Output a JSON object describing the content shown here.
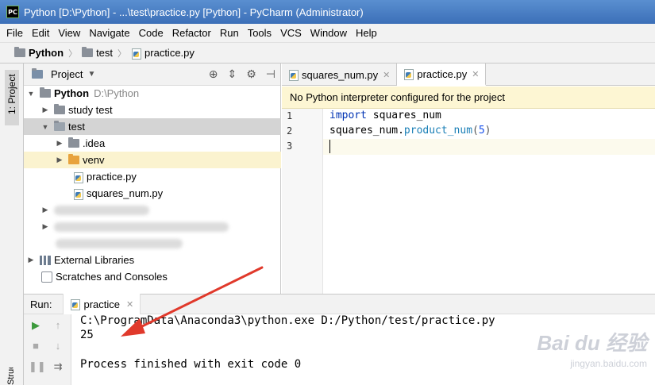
{
  "window": {
    "title": "Python [D:\\Python] - ...\\test\\practice.py [Python] - PyCharm (Administrator)",
    "app_icon_text": "PC"
  },
  "menu": [
    "File",
    "Edit",
    "View",
    "Navigate",
    "Code",
    "Refactor",
    "Run",
    "Tools",
    "VCS",
    "Window",
    "Help"
  ],
  "breadcrumb": [
    "Python",
    "test",
    "practice.py"
  ],
  "left_strip": {
    "project_tab": "1: Project",
    "structure_tab": "Structure"
  },
  "project_panel": {
    "title": "Project",
    "tree": [
      {
        "label": "Python",
        "suffix": "D:\\Python",
        "expanded": true
      },
      {
        "label": "study test",
        "expanded": false
      },
      {
        "label": "test",
        "expanded": true,
        "selected": true
      },
      {
        "label": ".idea",
        "expanded": false
      },
      {
        "label": "venv",
        "expanded": false
      },
      {
        "label": "practice.py"
      },
      {
        "label": "squares_num.py"
      },
      {
        "label": "External Libraries"
      },
      {
        "label": "Scratches and Consoles"
      }
    ]
  },
  "editor_tabs": [
    {
      "label": "squares_num.py",
      "active": false
    },
    {
      "label": "practice.py",
      "active": true
    }
  ],
  "banner": "No Python interpreter configured for the project",
  "editor": {
    "line_numbers": [
      "1",
      "2",
      "3"
    ],
    "line1": {
      "kw": "import",
      "rest": " squares_num"
    },
    "line2": {
      "obj": "squares_num",
      "dot": ".",
      "fn": "product_num",
      "open": "(",
      "arg": "5",
      "close": ")"
    }
  },
  "run_panel": {
    "label": "Run:",
    "tab": "practice",
    "output": [
      "C:\\ProgramData\\Anaconda3\\python.exe D:/Python/test/practice.py",
      "25",
      "",
      "Process finished with exit code 0"
    ]
  },
  "watermark": {
    "line1": "Bai du 经验",
    "line2": "jingyan.baidu.com"
  },
  "colors": {
    "titlebar": "#3c6fb8",
    "keyword": "#0033b3",
    "banner": "#fdf6d3",
    "arrow": "#e0392b"
  }
}
